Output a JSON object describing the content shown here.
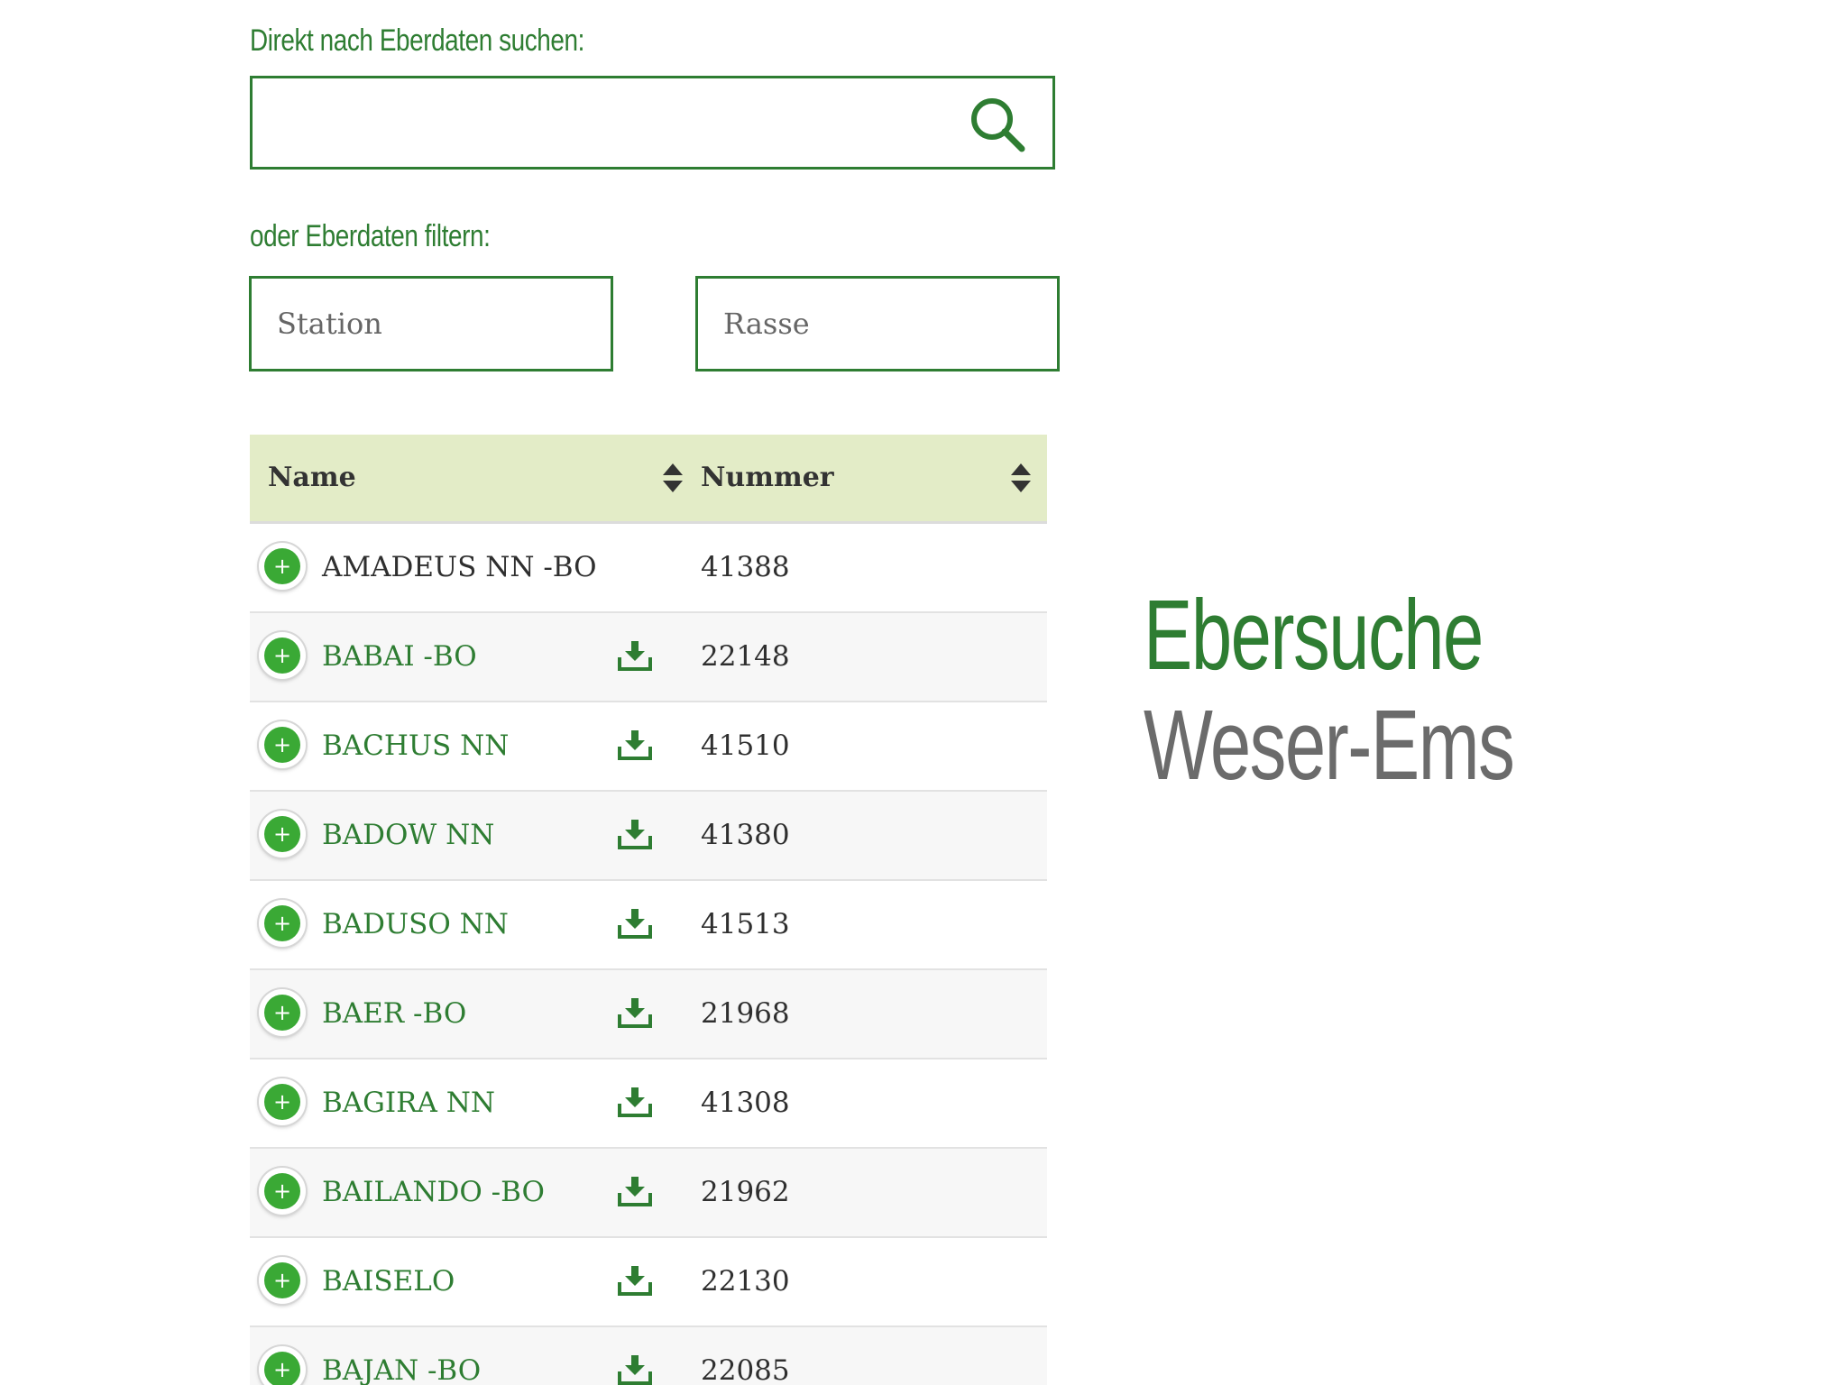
{
  "search": {
    "label": "Direkt nach Eberdaten suchen:",
    "value": "",
    "placeholder": ""
  },
  "filter": {
    "label": "oder Eberdaten filtern:",
    "station_placeholder": "Station",
    "rasse_placeholder": "Rasse"
  },
  "table": {
    "columns": [
      "Name",
      "Nummer"
    ],
    "rows": [
      {
        "name": "AMADEUS NN -BO",
        "nummer": "41388"
      },
      {
        "name": "BABAI -BO",
        "nummer": "22148"
      },
      {
        "name": "BACHUS NN",
        "nummer": "41510"
      },
      {
        "name": "BADOW NN",
        "nummer": "41380"
      },
      {
        "name": "BADUSO NN",
        "nummer": "41513"
      },
      {
        "name": "BAER -BO",
        "nummer": "21968"
      },
      {
        "name": "BAGIRA NN",
        "nummer": "41308"
      },
      {
        "name": "BAILANDO -BO",
        "nummer": "21962"
      },
      {
        "name": "BAISELO",
        "nummer": "22130"
      },
      {
        "name": "BAJAN -BO",
        "nummer": "22085"
      }
    ]
  },
  "brand": {
    "line1": "Ebersuche",
    "line2": "Weser-Ems"
  },
  "colors": {
    "accent": "#2e7d32",
    "header_bg": "#e3ecc7",
    "plus_green": "#3aa935",
    "brand_gray": "#6b6b6b"
  }
}
